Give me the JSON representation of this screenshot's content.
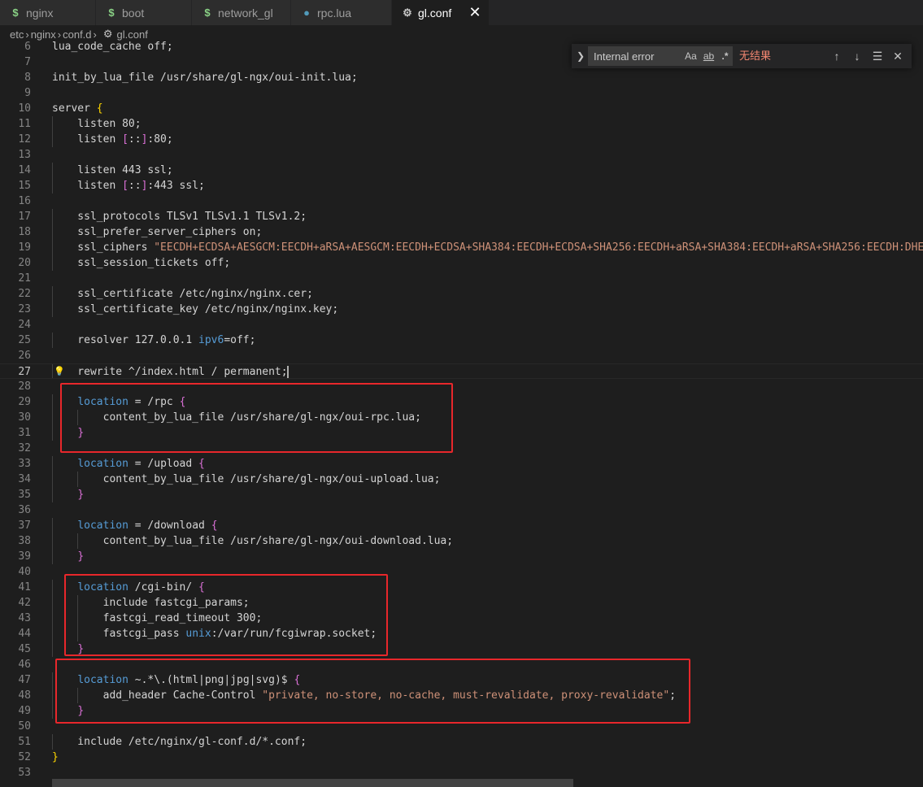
{
  "tabs": [
    {
      "label": "nginx",
      "icon": "dollar-icon"
    },
    {
      "label": "boot",
      "icon": "dollar-icon"
    },
    {
      "label": "network_gl",
      "icon": "dollar-icon"
    },
    {
      "label": "rpc.lua",
      "icon": "lua-icon"
    },
    {
      "label": "gl.conf",
      "icon": "gear-icon",
      "active": true,
      "close": "✕"
    }
  ],
  "breadcrumb": [
    "etc",
    "nginx",
    "conf.d",
    "gl.conf"
  ],
  "find": {
    "query": "Internal error",
    "match_case": "Aa",
    "whole_word": "ab",
    "regex": ".*",
    "status": "无结果",
    "status_color": "#f48771"
  },
  "editor": {
    "current_line": 27,
    "lines": [
      {
        "n": "6",
        "text": "lua_code_cache off;"
      },
      {
        "n": "7",
        "text": ""
      },
      {
        "n": "8",
        "text": "init_by_lua_file /usr/share/gl-ngx/oui-init.lua;"
      },
      {
        "n": "9",
        "text": ""
      },
      {
        "n": "10",
        "text": "server {"
      },
      {
        "n": "11",
        "text": "    listen 80;"
      },
      {
        "n": "12",
        "text": "    listen [::]:80;"
      },
      {
        "n": "13",
        "text": ""
      },
      {
        "n": "14",
        "text": "    listen 443 ssl;"
      },
      {
        "n": "15",
        "text": "    listen [::]:443 ssl;"
      },
      {
        "n": "16",
        "text": ""
      },
      {
        "n": "17",
        "text": "    ssl_protocols TLSv1 TLSv1.1 TLSv1.2;"
      },
      {
        "n": "18",
        "text": "    ssl_prefer_server_ciphers on;"
      },
      {
        "n": "19",
        "text": "    ssl_ciphers \"EECDH+ECDSA+AESGCM:EECDH+aRSA+AESGCM:EECDH+ECDSA+SHA384:EECDH+ECDSA+SHA256:EECDH+aRSA+SHA384:EECDH+aRSA+SHA256:EECDH:DHE+A"
      },
      {
        "n": "20",
        "text": "    ssl_session_tickets off;"
      },
      {
        "n": "21",
        "text": ""
      },
      {
        "n": "22",
        "text": "    ssl_certificate /etc/nginx/nginx.cer;"
      },
      {
        "n": "23",
        "text": "    ssl_certificate_key /etc/nginx/nginx.key;"
      },
      {
        "n": "24",
        "text": ""
      },
      {
        "n": "25",
        "text": "    resolver 127.0.0.1 ipv6=off;"
      },
      {
        "n": "26",
        "text": ""
      },
      {
        "n": "27",
        "text": "    rewrite ^/index.html / permanent;"
      },
      {
        "n": "28",
        "text": ""
      },
      {
        "n": "29",
        "text": "    location = /rpc {"
      },
      {
        "n": "30",
        "text": "        content_by_lua_file /usr/share/gl-ngx/oui-rpc.lua;"
      },
      {
        "n": "31",
        "text": "    }"
      },
      {
        "n": "32",
        "text": ""
      },
      {
        "n": "33",
        "text": "    location = /upload {"
      },
      {
        "n": "34",
        "text": "        content_by_lua_file /usr/share/gl-ngx/oui-upload.lua;"
      },
      {
        "n": "35",
        "text": "    }"
      },
      {
        "n": "36",
        "text": ""
      },
      {
        "n": "37",
        "text": "    location = /download {"
      },
      {
        "n": "38",
        "text": "        content_by_lua_file /usr/share/gl-ngx/oui-download.lua;"
      },
      {
        "n": "39",
        "text": "    }"
      },
      {
        "n": "40",
        "text": ""
      },
      {
        "n": "41",
        "text": "    location /cgi-bin/ {"
      },
      {
        "n": "42",
        "text": "        include fastcgi_params;"
      },
      {
        "n": "43",
        "text": "        fastcgi_read_timeout 300;"
      },
      {
        "n": "44",
        "text": "        fastcgi_pass unix:/var/run/fcgiwrap.socket;"
      },
      {
        "n": "45",
        "text": "    }"
      },
      {
        "n": "46",
        "text": ""
      },
      {
        "n": "47",
        "text": "    location ~.*\\.(html|png|jpg|svg)$ {"
      },
      {
        "n": "48",
        "text": "        add_header Cache-Control \"private, no-store, no-cache, must-revalidate, proxy-revalidate\";"
      },
      {
        "n": "49",
        "text": "    }"
      },
      {
        "n": "50",
        "text": ""
      },
      {
        "n": "51",
        "text": "    include /etc/nginx/gl-conf.d/*.conf;"
      },
      {
        "n": "52",
        "text": "}"
      },
      {
        "n": "53",
        "text": ""
      }
    ]
  },
  "colors": {
    "keyword": "#569cd6",
    "string": "#ce9178",
    "number": "#b5cea8",
    "bracket_level1": "#ffd700",
    "bracket_level2": "#da70d6",
    "highlight_box": "#e8272b"
  }
}
